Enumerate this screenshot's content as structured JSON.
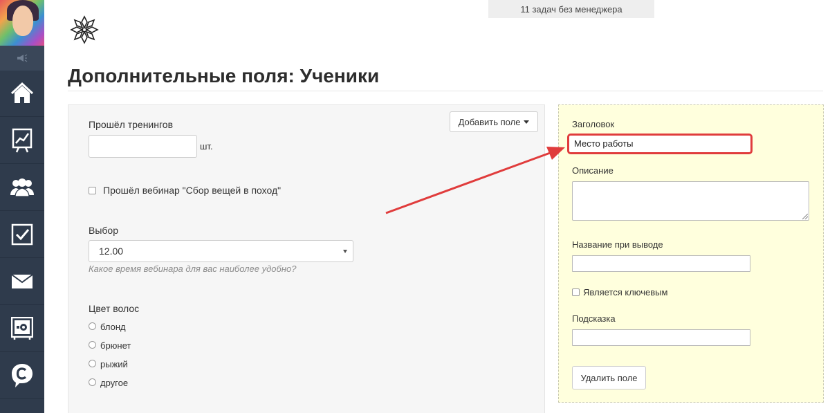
{
  "header": {
    "notice": "11 задач без менеджера",
    "page_title": "Дополнительные поля: Ученики"
  },
  "sidebar": {
    "items": [
      {
        "icon": "home-icon"
      },
      {
        "icon": "chart-icon"
      },
      {
        "icon": "users-icon"
      },
      {
        "icon": "tasks-icon"
      },
      {
        "icon": "mail-icon"
      },
      {
        "icon": "settings-safe-icon"
      },
      {
        "icon": "chat-icon"
      }
    ]
  },
  "form": {
    "add_field_button": "Добавить поле",
    "trainings": {
      "label": "Прошёл тренингов",
      "value": "",
      "unit": "шт."
    },
    "webinar_checkbox": {
      "label": "Прошёл вебинар \"Сбор вещей в поход\"",
      "checked": false
    },
    "choice": {
      "label": "Выбор",
      "selected": "12.00",
      "hint": "Какое время вебинара для вас наиболее удобно?"
    },
    "hair_color": {
      "label": "Цвет волос",
      "options": [
        "блонд",
        "брюнет",
        "рыжий",
        "другое"
      ]
    }
  },
  "edit": {
    "title_label": "Заголовок",
    "title_value": "Место работы",
    "description_label": "Описание",
    "description_value": "",
    "output_name_label": "Название при выводе",
    "output_name_value": "",
    "key_checkbox_label": "Является ключевым",
    "key_checked": false,
    "tooltip_label": "Подсказка",
    "tooltip_value": "",
    "delete_button": "Удалить поле"
  },
  "colors": {
    "sidebar": "#2f3b4c",
    "edit_panel": "#ffffdd",
    "highlight": "#e03c3c"
  }
}
